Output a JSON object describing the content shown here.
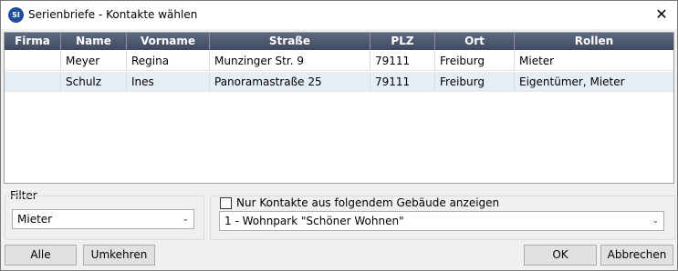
{
  "window": {
    "app_icon_text": "SI",
    "title": "Serienbriefe - Kontakte wählen",
    "close_glyph": "✕"
  },
  "table": {
    "columns": [
      "Firma",
      "Name",
      "Vorname",
      "Straße",
      "PLZ",
      "Ort",
      "Rollen"
    ],
    "rows": [
      {
        "Firma": "",
        "Name": "Meyer",
        "Vorname": "Regina",
        "Straße": "Munzinger Str. 9",
        "PLZ": "79111",
        "Ort": "Freiburg",
        "Rollen": "Mieter"
      },
      {
        "Firma": "",
        "Name": "Schulz",
        "Vorname": "Ines",
        "Straße": "Panoramastraße 25",
        "PLZ": "79111",
        "Ort": "Freiburg",
        "Rollen": "Eigentümer, Mieter"
      }
    ]
  },
  "filter": {
    "label": "Filter",
    "selected": "Mieter"
  },
  "building": {
    "checkbox_label": "Nur Kontakte aus folgendem Gebäude anzeigen",
    "checked": false,
    "selected": "1 - Wohnpark \"Schöner Wohnen\""
  },
  "buttons": {
    "all": "Alle",
    "invert": "Umkehren",
    "ok": "OK",
    "cancel": "Abbrechen"
  },
  "colors": {
    "header": "#4a5570",
    "alt_row": "#e6eef5",
    "accent": "#1f4e9c"
  }
}
